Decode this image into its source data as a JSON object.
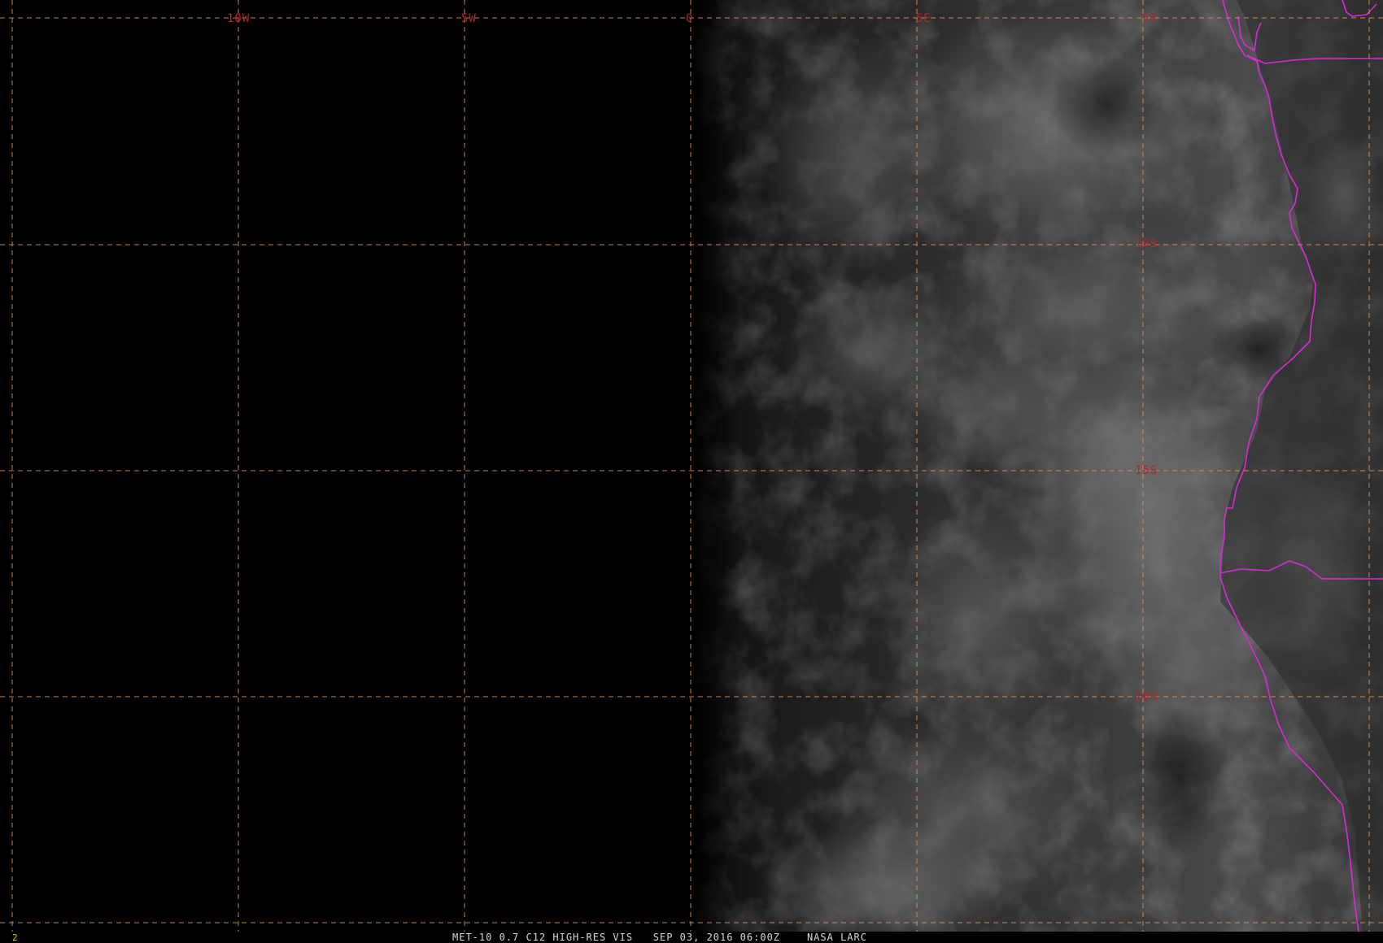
{
  "map": {
    "longitude_labels": [
      "10W",
      "5W",
      "0",
      "5E",
      "5S"
    ],
    "latitude_labels": [
      "10S",
      "15S",
      "20S"
    ],
    "grid_style": "dashed orange graticule",
    "colors": {
      "background": "#000000",
      "graticule": "#d7925a",
      "grid_labels": "#b3262a",
      "borders": "#d62ad6",
      "status_text": "#d8d8d8",
      "frame_number": "#e0c000"
    }
  },
  "status_bar": {
    "frame_number": "2",
    "product": "MET-10 0.7 C12 HIGH-RES VIS",
    "datetime": "SEP 03, 2016 06:00Z",
    "source": "NASA LARC"
  }
}
